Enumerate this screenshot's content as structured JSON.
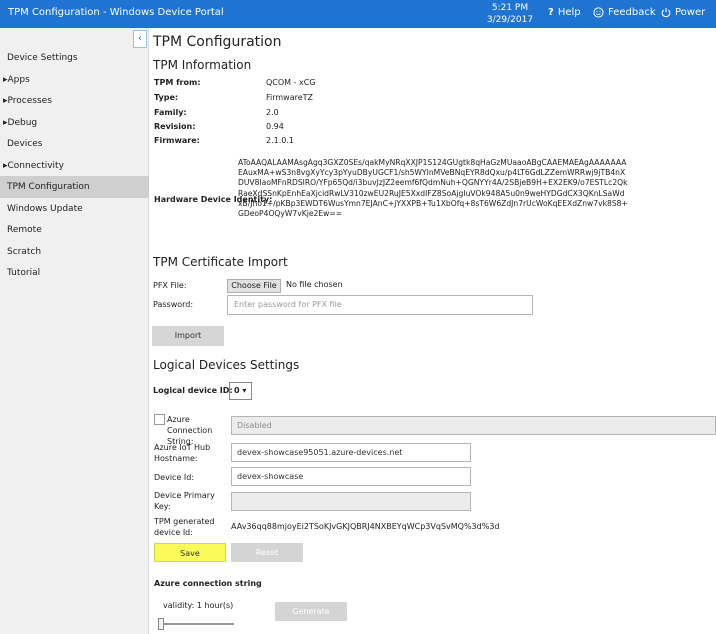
{
  "titlebar": {
    "app_title": "TPM Configuration - Windows Device Portal",
    "time": "5:21 PM",
    "date": "3/29/2017",
    "help_label": "Help",
    "feedback_label": "Feedback",
    "power_label": "Power"
  },
  "sidebar": {
    "collapse_glyph": "‹",
    "items": [
      {
        "label": "Device Settings"
      },
      {
        "label": "▸Apps"
      },
      {
        "label": "▸Processes"
      },
      {
        "label": "▸Debug"
      },
      {
        "label": "Devices"
      },
      {
        "label": "▸Connectivity"
      },
      {
        "label": "TPM Configuration"
      },
      {
        "label": "Windows Update"
      },
      {
        "label": "Remote"
      },
      {
        "label": "Scratch"
      },
      {
        "label": "Tutorial"
      }
    ]
  },
  "page": {
    "title": "TPM Configuration"
  },
  "tpm_info": {
    "heading": "TPM Information",
    "rows": [
      {
        "label": "TPM from:",
        "value": "QCOM - xCG"
      },
      {
        "label": "Type:",
        "value": "FirmwareTZ"
      },
      {
        "label": "Family:",
        "value": "2.0"
      },
      {
        "label": "Revision:",
        "value": "0.94"
      },
      {
        "label": "Firmware:",
        "value": "2.1.0.1"
      }
    ],
    "hw_id_label": "Hardware Device Identity:",
    "hw_id_value": "AToAAQALAAMAsgAgq3GXZ0SEs/qakMyNRqXXJP1S124GUgtk8qHaGzMUaaoABgCAAEMAEAgAAAAAAAEAuxMA+wS3n8vgXyYcy3pYyuDByUGCF1/sh5WYInMVeBNqEYR8dQxu/p4LT6GdLZZemWRRwj9jTB4nXDUV8IaoMFnRDSIRO/YFp65Qd/i3buvJzJZ2eemf6fQdmNuh+QGNYYr4A/2SBjeB9H+EX2EK9/o7ESTLc2QkRaeXdSSnKpEnhEaXjcidRwLV310zwEU2RuJE5XxdIFZ8SoAjgIuVOk948A5u0n9weHYDGdCX3QKnLSaWdxB/Jho1+/pKBp3EWDT6WusYmn7EJAnC+jYXXPB+Tu1XbOfq+8sT6W6ZdJn7rUcWoKqEEXdZnw7vk8S8+GDeoP4OQyW7vKje2Ew=="
  },
  "cert_import": {
    "heading": "TPM Certificate Import",
    "pfx_label": "PFX File:",
    "choose_file_label": "Choose File",
    "no_file_text": "No file chosen",
    "password_label": "Password:",
    "password_placeholder": "Enter password for PFX file",
    "import_label": "Import"
  },
  "logical_devices": {
    "heading": "Logical Devices Settings",
    "device_id_label": "Logical device ID:",
    "device_id_value": "0 ▾",
    "azure_conn_label": "Azure Connection String:",
    "azure_conn_value": "Disabled",
    "hostname_label": "Azure IoT Hub Hostname:",
    "hostname_value": "devex-showcase95051.azure-devices.net",
    "device_label": "Device Id:",
    "device_value": "devex-showcase",
    "primary_key_label": "Device Primary Key:",
    "primary_key_value": "",
    "generated_label": "TPM generated device Id:",
    "generated_value": "AAv36qq88mjoyEi2TSoKJvGKJQBRJ4NXBEYqWCp3VqSvMQ%3d%3d",
    "save_label": "Save",
    "reset_label": "Reset"
  },
  "azure_conn": {
    "heading": "Azure connection string",
    "validity_label": "validity: 1 hour(s)",
    "validity_level": 0,
    "generate_label": "Generate"
  }
}
